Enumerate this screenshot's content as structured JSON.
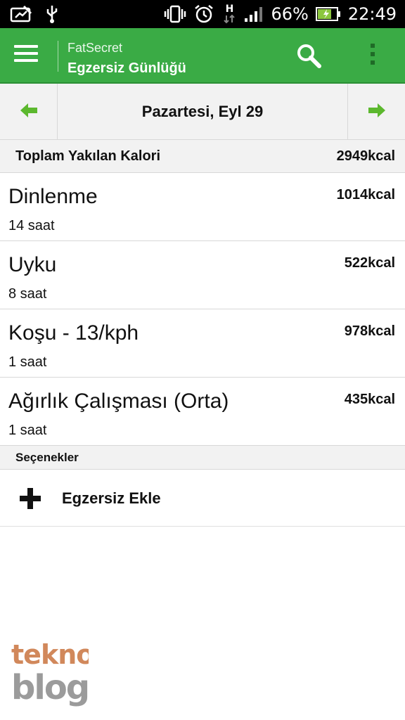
{
  "status_bar": {
    "battery_percent": "66%",
    "time": "22:49",
    "network_label": "H",
    "icons": [
      "image-edit-icon",
      "usb-icon",
      "vibrate-icon",
      "alarm-icon",
      "data-arrows-icon",
      "signal-icon",
      "battery-charging-icon"
    ]
  },
  "app_bar": {
    "app_name": "FatSecret",
    "screen_title": "Egzersiz Günlüğü",
    "menu_icon": "menu-icon",
    "search_icon": "search-icon",
    "overflow_icon": "overflow-menu-icon",
    "color": "#3aab45"
  },
  "date_nav": {
    "date": "Pazartesi, Eyl 29",
    "prev_icon": "arrow-left-icon",
    "next_icon": "arrow-right-icon",
    "arrow_color": "#5cb82e"
  },
  "total": {
    "label": "Toplam Yakılan Kalori",
    "value": "2949kcal"
  },
  "exercises": [
    {
      "name": "Dinlenme",
      "duration": "14 saat",
      "kcal": "1014kcal"
    },
    {
      "name": "Uyku",
      "duration": "8 saat",
      "kcal": "522kcal"
    },
    {
      "name": "Koşu - 13/kph",
      "duration": "1 saat",
      "kcal": "978kcal"
    },
    {
      "name": "Ağırlık Çalışması (Orta)",
      "duration": "1 saat",
      "kcal": "435kcal"
    }
  ],
  "options": {
    "header": "Seçenekler",
    "add_label": "Egzersiz Ekle",
    "add_icon": "plus-icon"
  },
  "watermark": {
    "line1": "tekno",
    "line2": "blog"
  }
}
